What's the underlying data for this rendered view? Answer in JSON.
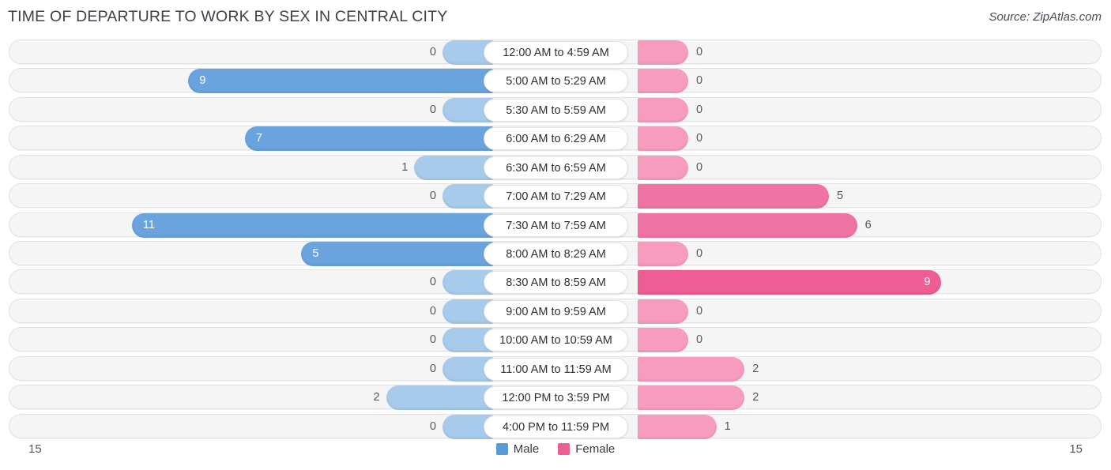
{
  "header": {
    "title": "TIME OF DEPARTURE TO WORK BY SEX IN CENTRAL CITY",
    "source": "Source: ZipAtlas.com"
  },
  "footer": {
    "axis_left": "15",
    "axis_right": "15",
    "legend": [
      {
        "name": "male-legend",
        "label": "Male",
        "color": "#5B9BD5"
      },
      {
        "name": "female-legend",
        "label": "Female",
        "color": "#EC5F95"
      }
    ]
  },
  "colors": {
    "male_strong": "#6AA3DE",
    "male_light": "#A8CBEC",
    "female_strong": "#EE5D93",
    "female_mid": "#F173A4",
    "female_light": "#F79CBE",
    "track": "#F5F5F5",
    "track_border": "#E2E2E2"
  },
  "chart_data": {
    "type": "bar",
    "orientation": "horizontal-diverging",
    "title": "TIME OF DEPARTURE TO WORK BY SEX IN CENTRAL CITY",
    "xlabel": "",
    "ylabel": "",
    "xlim": [
      15,
      15
    ],
    "axis_max": 15,
    "grid": false,
    "legend_position": "bottom-center",
    "categories": [
      "12:00 AM to 4:59 AM",
      "5:00 AM to 5:29 AM",
      "5:30 AM to 5:59 AM",
      "6:00 AM to 6:29 AM",
      "6:30 AM to 6:59 AM",
      "7:00 AM to 7:29 AM",
      "7:30 AM to 7:59 AM",
      "8:00 AM to 8:29 AM",
      "8:30 AM to 8:59 AM",
      "9:00 AM to 9:59 AM",
      "10:00 AM to 10:59 AM",
      "11:00 AM to 11:59 AM",
      "12:00 PM to 3:59 PM",
      "4:00 PM to 11:59 PM"
    ],
    "series": [
      {
        "name": "Male",
        "side": "left",
        "values": [
          0,
          9,
          0,
          7,
          1,
          0,
          11,
          5,
          0,
          0,
          0,
          0,
          2,
          0
        ]
      },
      {
        "name": "Female",
        "side": "right",
        "values": [
          0,
          0,
          0,
          0,
          0,
          5,
          6,
          0,
          9,
          0,
          0,
          2,
          2,
          1
        ]
      }
    ]
  }
}
